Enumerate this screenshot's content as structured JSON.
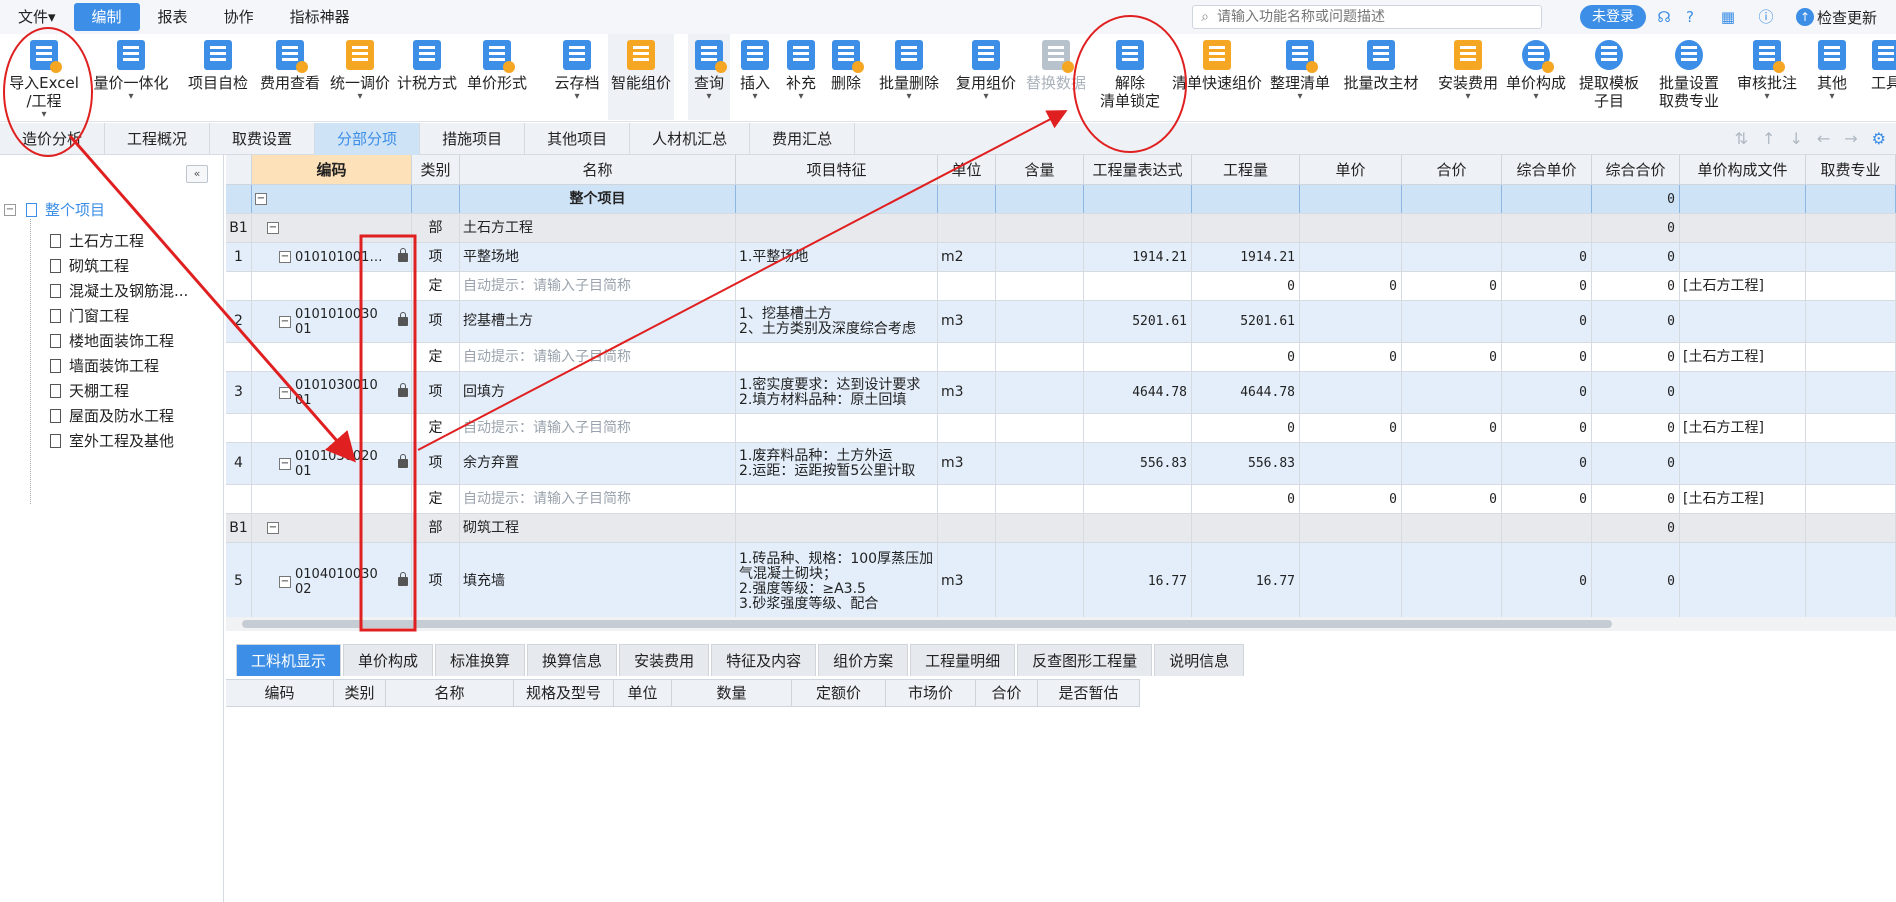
{
  "menu": {
    "items": [
      "文件▾",
      "编制",
      "报表",
      "协作",
      "指标神器"
    ],
    "active": 1
  },
  "search": {
    "placeholder": "请输入功能名称或问题描述"
  },
  "header": {
    "login_label": "未登录",
    "update_label": "检查更新"
  },
  "ribbon": [
    {
      "label": "导入Excel\n/工程",
      "icon": "import-excel-icon",
      "caret": true
    },
    {
      "label": "量价一体化",
      "icon": "integration-icon",
      "caret": true
    },
    {
      "label": "项目自检",
      "icon": "self-check-icon"
    },
    {
      "label": "费用查看",
      "icon": "fee-view-icon"
    },
    {
      "label": "统一调价",
      "icon": "adjust-price-icon",
      "caret": true
    },
    {
      "label": "计税方式",
      "icon": "tax-icon"
    },
    {
      "label": "单价形式",
      "icon": "unit-price-icon"
    },
    {
      "label": "云存档",
      "icon": "cloud-save-icon",
      "caret": true
    },
    {
      "label": "智能组价",
      "icon": "smart-price-icon"
    },
    {
      "label": "查询",
      "icon": "query-icon",
      "caret": true
    },
    {
      "label": "插入",
      "icon": "insert-icon",
      "caret": true
    },
    {
      "label": "补充",
      "icon": "supplement-icon",
      "caret": true
    },
    {
      "label": "删除",
      "icon": "delete-icon"
    },
    {
      "label": "批量删除",
      "icon": "batch-delete-icon",
      "caret": true
    },
    {
      "label": "复用组价",
      "icon": "reuse-price-icon",
      "caret": true
    },
    {
      "label": "替换数据",
      "icon": "replace-data-icon",
      "disabled": true
    },
    {
      "label": "解除\n清单锁定",
      "icon": "unlock-list-icon"
    },
    {
      "label": "清单快速组价",
      "icon": "quick-price-icon"
    },
    {
      "label": "整理清单",
      "icon": "organize-list-icon",
      "caret": true
    },
    {
      "label": "批量改主材",
      "icon": "batch-material-icon"
    },
    {
      "label": "安装费用",
      "icon": "install-fee-icon",
      "caret": true
    },
    {
      "label": "单价构成",
      "icon": "price-composition-icon",
      "caret": true
    },
    {
      "label": "提取模板\n子目",
      "icon": "template-icon"
    },
    {
      "label": "批量设置\n取费专业",
      "icon": "batch-fee-icon"
    },
    {
      "label": "审核批注",
      "icon": "review-icon",
      "caret": true
    },
    {
      "label": "其他",
      "icon": "other-icon",
      "caret": true
    },
    {
      "label": "工具",
      "icon": "tools-icon"
    }
  ],
  "tabs": [
    "造价分析",
    "工程概况",
    "取费设置",
    "分部分项",
    "措施项目",
    "其他项目",
    "人材机汇总",
    "费用汇总"
  ],
  "active_tab": 3,
  "tree": {
    "root": "整个项目",
    "items": [
      "土石方工程",
      "砌筑工程",
      "混凝土及钢筋混...",
      "门窗工程",
      "楼地面装饰工程",
      "墙面装饰工程",
      "天棚工程",
      "屋面及防水工程",
      "室外工程及基他"
    ]
  },
  "grid": {
    "columns": [
      "",
      "编码",
      "类别",
      "名称",
      "项目特征",
      "单位",
      "含量",
      "工程量表达式",
      "工程量",
      "单价",
      "合价",
      "综合单价",
      "综合合价",
      "单价构成文件",
      "取费专业"
    ],
    "rows": [
      {
        "type": "sel",
        "seq": "",
        "code": "",
        "kind": "",
        "name": "整个项目",
        "feature": "",
        "unit": "",
        "content": "",
        "expr": "",
        "qty": "",
        "price": "",
        "total": "",
        "cprice": "",
        "ctotal": "0",
        "file": "",
        "fee": ""
      },
      {
        "type": "part",
        "seq": "B1",
        "code": "",
        "kind": "部",
        "name": "土石方工程",
        "feature": "",
        "unit": "",
        "content": "",
        "expr": "",
        "qty": "",
        "price": "",
        "total": "",
        "cprice": "",
        "ctotal": "0",
        "file": "",
        "fee": ""
      },
      {
        "type": "item",
        "seq": "1",
        "code": "010101001…",
        "kind": "项",
        "name": "平整场地",
        "feature": "1.平整场地",
        "unit": "m2",
        "content": "",
        "expr": "1914.21",
        "qty": "1914.21",
        "price": "",
        "total": "",
        "cprice": "0",
        "ctotal": "0",
        "file": "",
        "fee": ""
      },
      {
        "type": "def",
        "seq": "",
        "code": "",
        "kind": "定",
        "name": "自动提示：请输入子目简称",
        "feature": "",
        "unit": "",
        "content": "",
        "expr": "",
        "qty": "0",
        "price": "0",
        "total": "0",
        "cprice": "0",
        "ctotal": "0",
        "file": "[土石方工程]",
        "fee": ""
      },
      {
        "type": "item",
        "seq": "2",
        "code": "0101010030\n01",
        "kind": "项",
        "name": "挖基槽土方",
        "feature": "1、挖基槽土方\n2、土方类别及深度综合考虑",
        "unit": "m3",
        "content": "",
        "expr": "5201.61",
        "qty": "5201.61",
        "price": "",
        "total": "",
        "cprice": "0",
        "ctotal": "0",
        "file": "",
        "fee": ""
      },
      {
        "type": "def",
        "seq": "",
        "code": "",
        "kind": "定",
        "name": "自动提示：请输入子目简称",
        "feature": "",
        "unit": "",
        "content": "",
        "expr": "",
        "qty": "0",
        "price": "0",
        "total": "0",
        "cprice": "0",
        "ctotal": "0",
        "file": "[土石方工程]",
        "fee": ""
      },
      {
        "type": "item",
        "seq": "3",
        "code": "0101030010\n01",
        "kind": "项",
        "name": "回填方",
        "feature": "1.密实度要求：达到设计要求\n2.填方材料品种：原土回填",
        "unit": "m3",
        "content": "",
        "expr": "4644.78",
        "qty": "4644.78",
        "price": "",
        "total": "",
        "cprice": "0",
        "ctotal": "0",
        "file": "",
        "fee": ""
      },
      {
        "type": "def",
        "seq": "",
        "code": "",
        "kind": "定",
        "name": "自动提示：请输入子目简称",
        "feature": "",
        "unit": "",
        "content": "",
        "expr": "",
        "qty": "0",
        "price": "0",
        "total": "0",
        "cprice": "0",
        "ctotal": "0",
        "file": "[土石方工程]",
        "fee": ""
      },
      {
        "type": "item",
        "seq": "4",
        "code": "0101030020\n01",
        "kind": "项",
        "name": "余方弃置",
        "feature": "1.废弃料品种：土方外运\n2.运距：运距按暂5公里计取",
        "unit": "m3",
        "content": "",
        "expr": "556.83",
        "qty": "556.83",
        "price": "",
        "total": "",
        "cprice": "0",
        "ctotal": "0",
        "file": "",
        "fee": ""
      },
      {
        "type": "def",
        "seq": "",
        "code": "",
        "kind": "定",
        "name": "自动提示：请输入子目简称",
        "feature": "",
        "unit": "",
        "content": "",
        "expr": "",
        "qty": "0",
        "price": "0",
        "total": "0",
        "cprice": "0",
        "ctotal": "0",
        "file": "[土石方工程]",
        "fee": ""
      },
      {
        "type": "part",
        "seq": "B1",
        "code": "",
        "kind": "部",
        "name": "砌筑工程",
        "feature": "",
        "unit": "",
        "content": "",
        "expr": "",
        "qty": "",
        "price": "",
        "total": "",
        "cprice": "",
        "ctotal": "0",
        "file": "",
        "fee": ""
      },
      {
        "type": "item",
        "seq": "5",
        "code": "0104010030\n02",
        "kind": "项",
        "name": "填充墙",
        "feature": "1.砖品种、规格：100厚蒸压加气混凝土砌块；\n2.强度等级：≥A3.5\n3.砂浆强度等级、配合",
        "unit": "m3",
        "content": "",
        "expr": "16.77",
        "qty": "16.77",
        "price": "",
        "total": "",
        "cprice": "0",
        "ctotal": "0",
        "file": "",
        "fee": ""
      }
    ]
  },
  "bottom_tabs": [
    "工料机显示",
    "单价构成",
    "标准换算",
    "换算信息",
    "安装费用",
    "特征及内容",
    "组价方案",
    "工程量明细",
    "反查图形工程量",
    "说明信息"
  ],
  "bottom_active": 0,
  "bottom_columns": [
    "编码",
    "类别",
    "名称",
    "规格及型号",
    "单位",
    "数量",
    "定额价",
    "市场价",
    "合价",
    "是否暂估"
  ]
}
